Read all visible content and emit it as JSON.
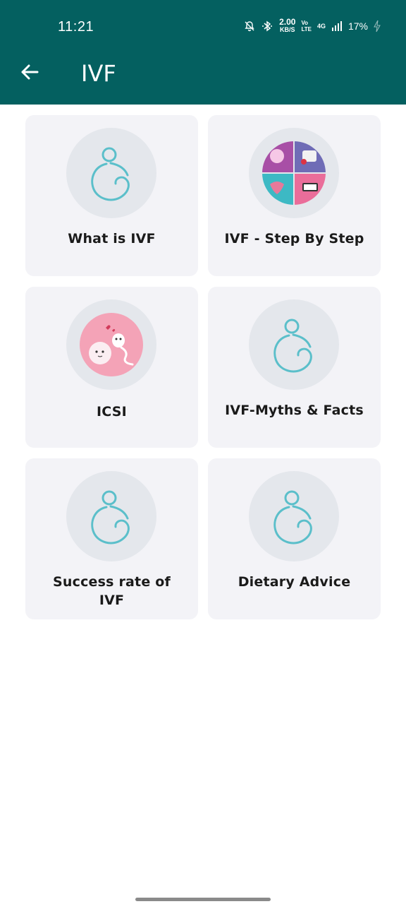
{
  "status_bar": {
    "time": "11:21",
    "net_speed_value": "2.00",
    "net_speed_unit": "KB/S",
    "volte_top": "Vo",
    "volte_bottom": "LTE",
    "network": "4G",
    "battery": "17%"
  },
  "app_bar": {
    "title": "IVF",
    "back_icon": "arrow-left-icon",
    "background": "#046060"
  },
  "cards": [
    {
      "label": "What is IVF",
      "icon": "pregnancy-icon"
    },
    {
      "label": "IVF - Step By Step",
      "icon": "ivf-steps-image"
    },
    {
      "label": "ICSI",
      "icon": "icsi-image"
    },
    {
      "label": "IVF-Myths & Facts",
      "icon": "pregnancy-icon"
    },
    {
      "label": "Success rate of IVF",
      "icon": "pregnancy-icon"
    },
    {
      "label": "Dietary Advice",
      "icon": "pregnancy-icon"
    }
  ],
  "colors": {
    "accent": "#046060",
    "card_bg": "#f3f3f7",
    "icon_teal": "#5bbfca"
  }
}
